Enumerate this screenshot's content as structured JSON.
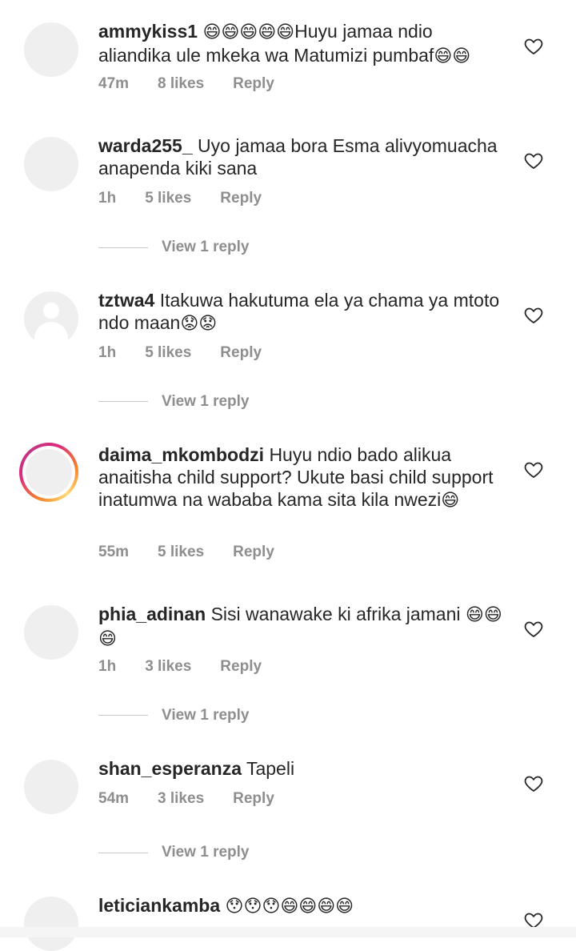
{
  "comments": [
    {
      "user": "ammykiss1",
      "emoji_pre": "😄😄😄😄😄",
      "text": "Huyu jamaa ndio aliandika ule mkeka wa Matumizi pumbaf",
      "emoji_post": "😄😄",
      "time": "47m",
      "likes": "8 likes",
      "reply": "Reply"
    },
    {
      "user": "warda255_",
      "emoji_pre": "",
      "text": "Uyo jamaa bora Esma alivyomuacha  anapenda kiki sana",
      "emoji_post": "",
      "time": "1h",
      "likes": "5 likes",
      "reply": "Reply",
      "view_replies": "View 1 reply"
    },
    {
      "user": "tztwa4",
      "emoji_pre": "",
      "text": "Itakuwa hakutuma ela ya chama ya mtoto ndo maan",
      "emoji_post": "😟😟",
      "time": "1h",
      "likes": "5 likes",
      "reply": "Reply",
      "view_replies": "View 1 reply"
    },
    {
      "user": "daima_mkombodzi",
      "emoji_pre": "",
      "text": "Huyu ndio bado alikua anaitisha child support? Ukute basi child support inatumwa na wababa kama sita kila nwezi",
      "emoji_post": "😄",
      "time": "55m",
      "likes": "5 likes",
      "reply": "Reply"
    },
    {
      "user": "phia_adinan",
      "emoji_pre": "",
      "text": "Sisi wanawake ki afrika jamani ",
      "emoji_post": "😄😄😄",
      "time": "1h",
      "likes": "3 likes",
      "reply": "Reply",
      "view_replies": "View 1 reply"
    },
    {
      "user": "shan_esperanza",
      "emoji_pre": "",
      "text": "Tapeli",
      "emoji_post": "",
      "time": "54m",
      "likes": "3 likes",
      "reply": "Reply",
      "view_replies": "View 1 reply"
    },
    {
      "user": "leticiankamba",
      "emoji_pre": "😯😯😯😄😄😄😄",
      "text": "",
      "emoji_post": "",
      "time": "",
      "likes": "",
      "reply": ""
    }
  ],
  "icons": {
    "like": "heart-outline-icon",
    "avatar": "default-avatar-icon"
  },
  "colors": {
    "text": "#262626",
    "muted": "#8e8e8e",
    "story_ring": "#dd2a7b"
  }
}
